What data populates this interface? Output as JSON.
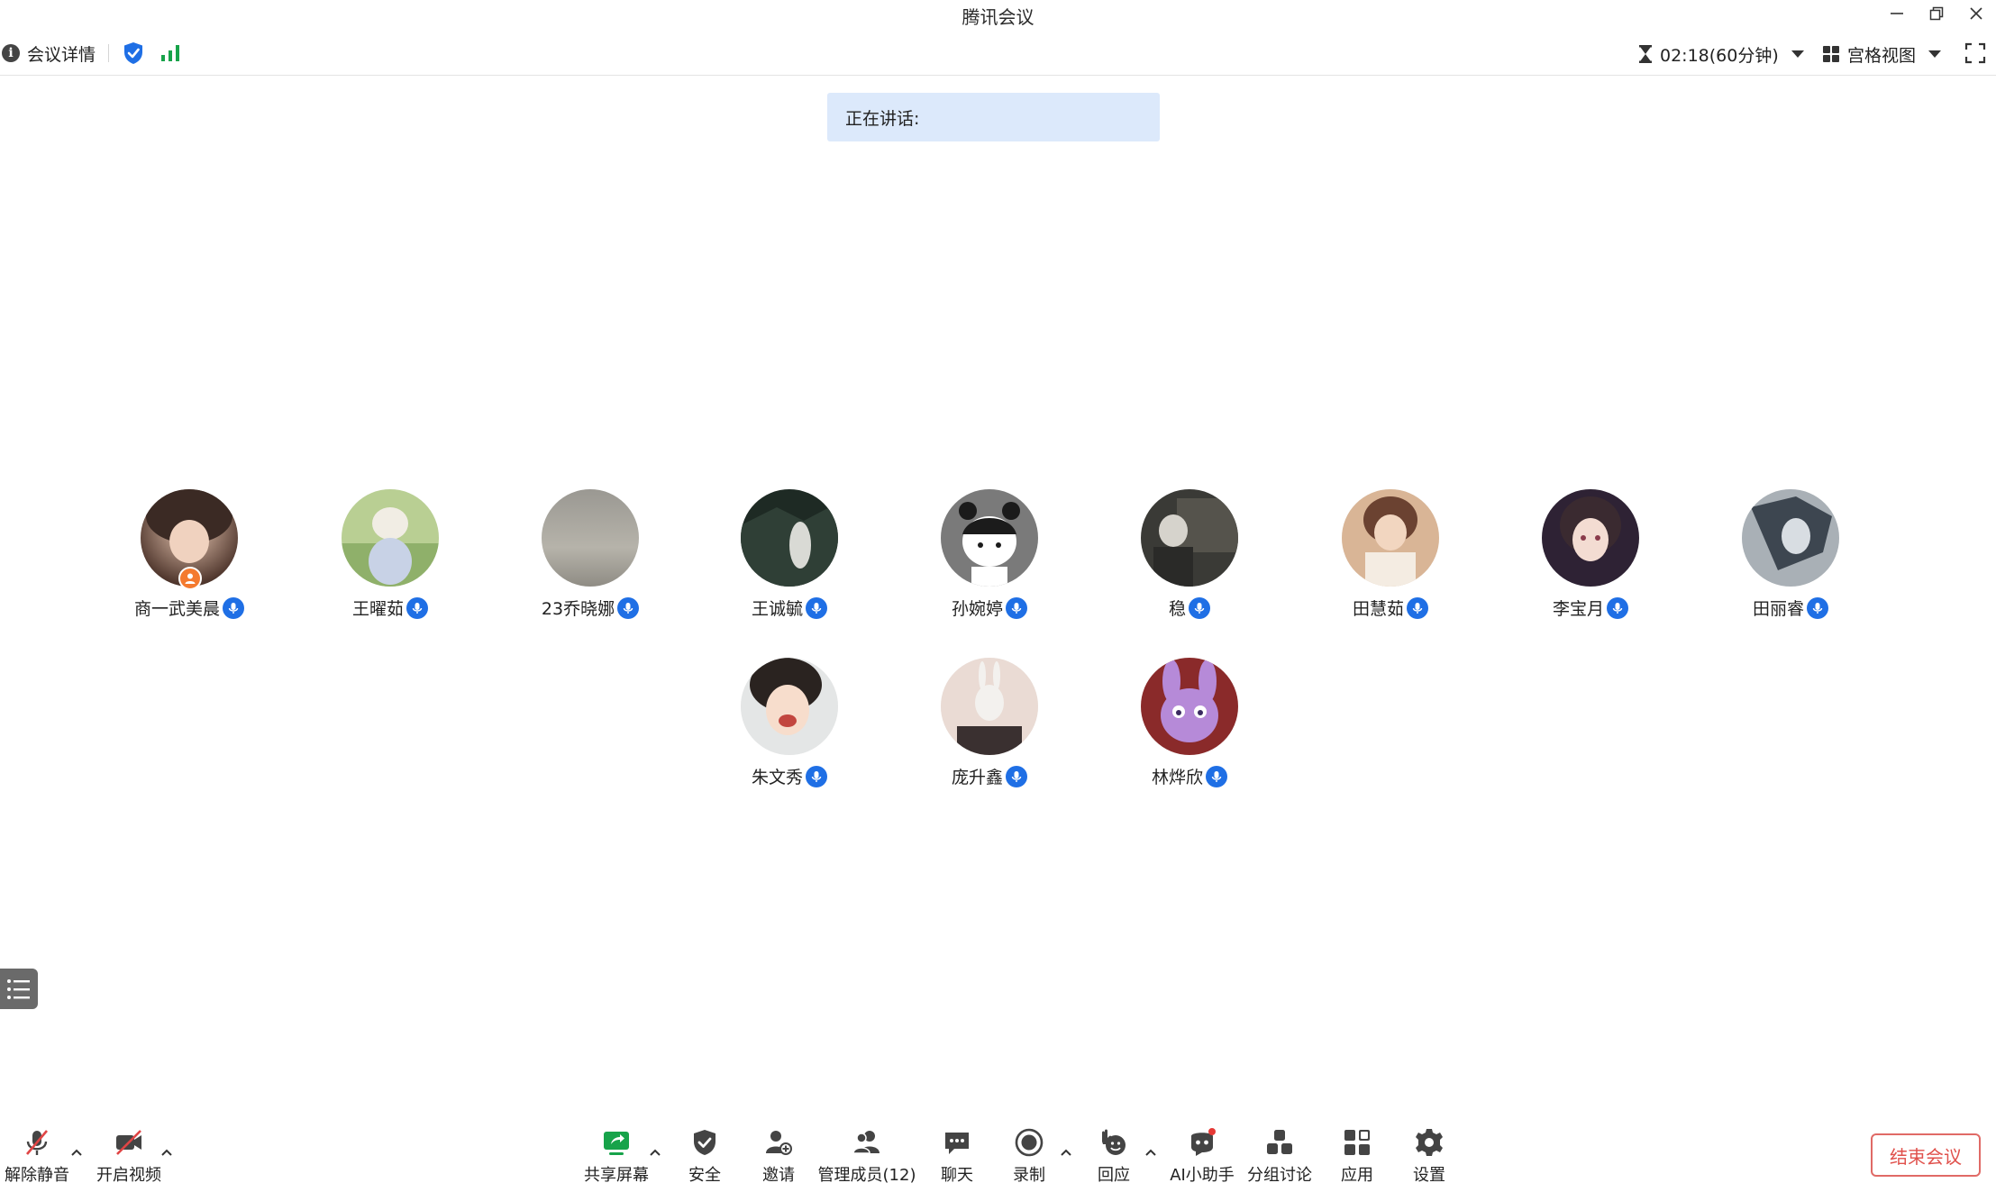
{
  "window": {
    "title": "腾讯会议"
  },
  "infobar": {
    "meeting_info_label": "会议详情",
    "info_icon_glyph": "i",
    "timer": "02:18(60分钟)",
    "view_mode": "宫格视图"
  },
  "speaking": {
    "label": "正在讲话:"
  },
  "participants": [
    {
      "name": "商一武美晨",
      "host": true
    },
    {
      "name": "王曜茹"
    },
    {
      "name": "23乔晓娜"
    },
    {
      "name": "王诚毓"
    },
    {
      "name": "孙婉婷"
    },
    {
      "name": "稳"
    },
    {
      "name": "田慧茹"
    },
    {
      "name": "李宝月"
    },
    {
      "name": "田丽睿"
    },
    {
      "name": "朱文秀"
    },
    {
      "name": "庞升鑫"
    },
    {
      "name": "林烨欣"
    }
  ],
  "toolbar": {
    "unmute": "解除静音",
    "start_video": "开启视频",
    "share_screen": "共享屏幕",
    "security": "安全",
    "invite": "邀请",
    "manage_members": "管理成员(12)",
    "chat": "聊天",
    "record": "录制",
    "reactions": "回应",
    "ai_assistant": "AI小助手",
    "breakout": "分组讨论",
    "apps": "应用",
    "settings": "设置",
    "end_meeting": "结束会议"
  },
  "colors": {
    "accent_blue": "#1f6fe5",
    "speaking_bg": "#dce9fb",
    "end_red": "#e0514c",
    "share_green": "#17a34a",
    "host_orange": "#f47a2f"
  }
}
